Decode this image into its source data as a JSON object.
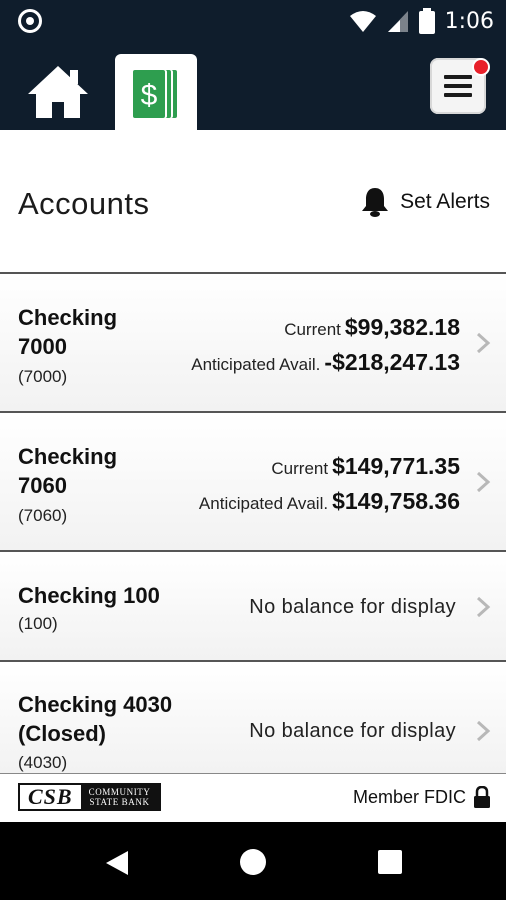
{
  "status_bar": {
    "time": "1:06"
  },
  "header": {
    "tabs": [
      {
        "name": "home",
        "icon": "home-icon"
      },
      {
        "name": "accounts",
        "icon": "money-icon",
        "active": true
      }
    ],
    "menu_icon": "hamburger-menu-icon",
    "notification_color": "#e8202a"
  },
  "page": {
    "title": "Accounts",
    "set_alerts_label": "Set Alerts"
  },
  "accounts": [
    {
      "name_line1": "Checking",
      "name_line2": "7000",
      "number": "(7000)",
      "current_label": "Current",
      "current_value": "$99,382.18",
      "avail_label": "Anticipated Avail.",
      "avail_value": "-$218,247.13"
    },
    {
      "name_line1": "Checking",
      "name_line2": "7060",
      "number": "(7060)",
      "current_label": "Current",
      "current_value": "$149,771.35",
      "avail_label": "Anticipated Avail.",
      "avail_value": "$149,758.36"
    },
    {
      "name_line1": "Checking 100",
      "number": "(100)",
      "no_balance": "No balance for display"
    },
    {
      "name_line1": "Checking 4030",
      "name_line2": "(Closed)",
      "number": "(4030)",
      "no_balance": "No balance for display"
    }
  ],
  "footer": {
    "logo_letters": "CSB",
    "logo_line1": "COMMUNITY",
    "logo_line2": "STATE BANK",
    "member_label": "Member FDIC"
  },
  "colors": {
    "header_bg": "#0f1d2c",
    "money_green": "#2e9e4f",
    "divider": "#555555"
  }
}
